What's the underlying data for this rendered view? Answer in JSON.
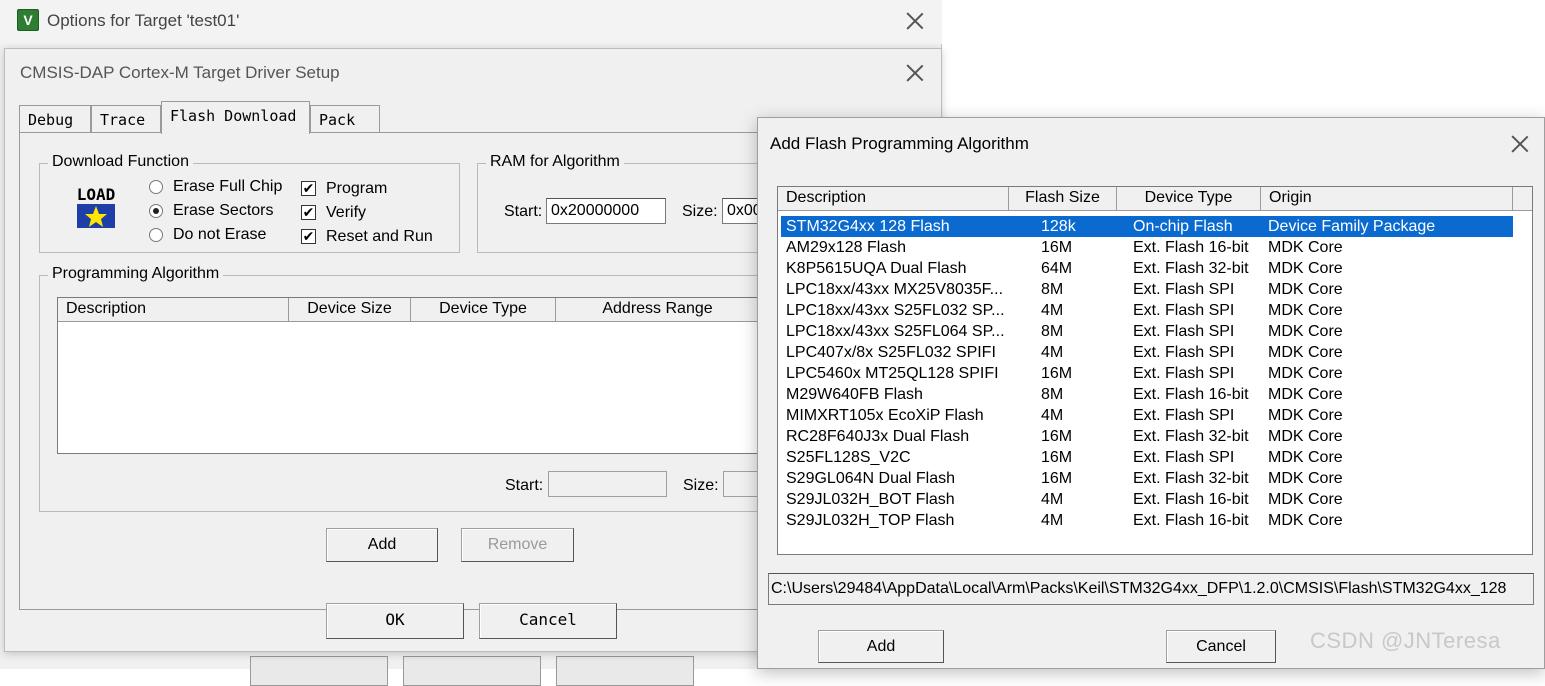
{
  "outer_window": {
    "title": "Options for Target 'test01'",
    "app_icon": "keil-uvision-icon"
  },
  "inner_window": {
    "title": "CMSIS-DAP Cortex-M Target Driver Setup",
    "tabs": [
      {
        "label": "Debug"
      },
      {
        "label": "Trace"
      },
      {
        "label": "Flash Download",
        "active": true
      },
      {
        "label": "Pack"
      }
    ],
    "download_function": {
      "group_label": "Download Function",
      "icon_text": "LOAD",
      "radios": [
        {
          "label": "Erase Full Chip",
          "selected": false
        },
        {
          "label": "Erase Sectors",
          "selected": true
        },
        {
          "label": "Do not Erase",
          "selected": false
        }
      ],
      "checks": [
        {
          "label": "Program",
          "checked": true,
          "mark": "✔"
        },
        {
          "label": "Verify",
          "checked": true,
          "mark": "✔"
        },
        {
          "label": "Reset and Run",
          "checked": true,
          "mark": "✔"
        }
      ]
    },
    "ram_for_algorithm": {
      "group_label": "RAM for Algorithm",
      "start_label": "Start:",
      "start_value": "0x20000000",
      "size_label": "Size:",
      "size_value": "0x00"
    },
    "programming_algorithm": {
      "group_label": "Programming Algorithm",
      "columns": [
        "Description",
        "Device Size",
        "Device Type",
        "Address Range"
      ],
      "start_label": "Start:",
      "size_label": "Size:"
    },
    "buttons": {
      "add": "Add",
      "remove": "Remove",
      "ok": "OK",
      "cancel": "Cancel"
    }
  },
  "dialog": {
    "title": "Add Flash Programming Algorithm",
    "columns": [
      "Description",
      "Flash Size",
      "Device Type",
      "Origin"
    ],
    "rows": [
      {
        "desc": "STM32G4xx 128 Flash",
        "size": "128k",
        "type": "On-chip Flash",
        "origin": "Device Family Package",
        "selected": true
      },
      {
        "desc": "AM29x128 Flash",
        "size": "16M",
        "type": "Ext. Flash 16-bit",
        "origin": "MDK Core"
      },
      {
        "desc": "K8P5615UQA Dual Flash",
        "size": "64M",
        "type": "Ext. Flash 32-bit",
        "origin": "MDK Core"
      },
      {
        "desc": "LPC18xx/43xx MX25V8035F...",
        "size": "8M",
        "type": "Ext. Flash SPI",
        "origin": "MDK Core"
      },
      {
        "desc": "LPC18xx/43xx S25FL032 SP...",
        "size": "4M",
        "type": "Ext. Flash SPI",
        "origin": "MDK Core"
      },
      {
        "desc": "LPC18xx/43xx S25FL064 SP...",
        "size": "8M",
        "type": "Ext. Flash SPI",
        "origin": "MDK Core"
      },
      {
        "desc": "LPC407x/8x S25FL032 SPIFI",
        "size": "4M",
        "type": "Ext. Flash SPI",
        "origin": "MDK Core"
      },
      {
        "desc": "LPC5460x MT25QL128 SPIFI",
        "size": "16M",
        "type": "Ext. Flash SPI",
        "origin": "MDK Core"
      },
      {
        "desc": "M29W640FB Flash",
        "size": "8M",
        "type": "Ext. Flash 16-bit",
        "origin": "MDK Core"
      },
      {
        "desc": "MIMXRT105x EcoXiP Flash",
        "size": "4M",
        "type": "Ext. Flash SPI",
        "origin": "MDK Core"
      },
      {
        "desc": "RC28F640J3x Dual Flash",
        "size": "16M",
        "type": "Ext. Flash 32-bit",
        "origin": "MDK Core"
      },
      {
        "desc": "S25FL128S_V2C",
        "size": "16M",
        "type": "Ext. Flash SPI",
        "origin": "MDK Core"
      },
      {
        "desc": "S29GL064N Dual Flash",
        "size": "16M",
        "type": "Ext. Flash 32-bit",
        "origin": "MDK Core"
      },
      {
        "desc": "S29JL032H_BOT Flash",
        "size": "4M",
        "type": "Ext. Flash 16-bit",
        "origin": "MDK Core"
      },
      {
        "desc": "S29JL032H_TOP Flash",
        "size": "4M",
        "type": "Ext. Flash 16-bit",
        "origin": "MDK Core"
      }
    ],
    "path": "C:\\Users\\29484\\AppData\\Local\\Arm\\Packs\\Keil\\STM32G4xx_DFP\\1.2.0\\CMSIS\\Flash\\STM32G4xx_128",
    "add_label": "Add",
    "cancel_label": "Cancel"
  },
  "watermark": "CSDN @JNTeresa"
}
